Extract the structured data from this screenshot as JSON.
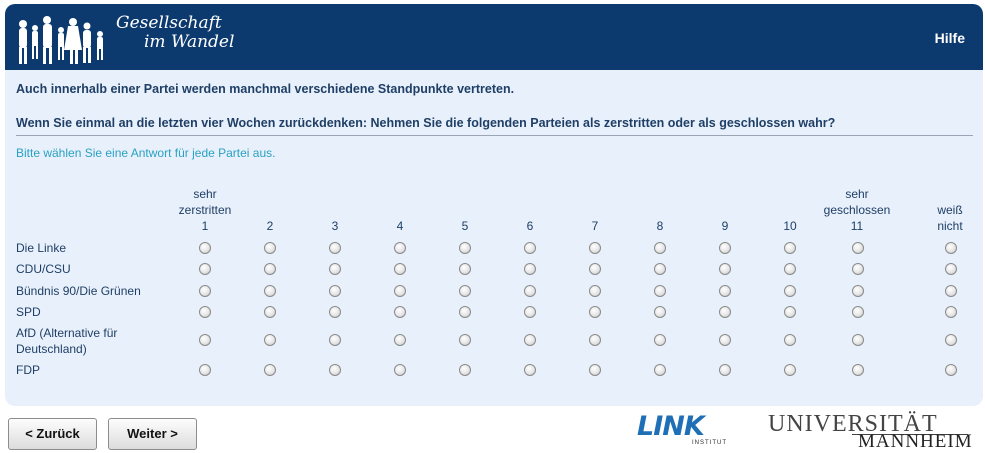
{
  "header": {
    "brand_line1": "Gesellschaft",
    "brand_line2": "im Wandel",
    "help_label": "Hilfe",
    "bg_color": "#0c3a6e"
  },
  "survey": {
    "intro": "Auch innerhalb einer Partei werden manchmal verschiedene Standpunkte vertreten.",
    "question": "Wenn Sie einmal an die letzten vier Wochen zurückdenken: Nehmen Sie die folgenden Parteien als zerstritten oder als geschlossen wahr?",
    "instruction": "Bitte wählen Sie eine Antwort für jede Partei aus.",
    "scale_labels": {
      "low_word1": "sehr",
      "low_word2": "zerstritten",
      "high_word1": "sehr",
      "high_word2": "geschlossen",
      "dk_word1": "weiß",
      "dk_word2": "nicht"
    },
    "columns": [
      "1",
      "2",
      "3",
      "4",
      "5",
      "6",
      "7",
      "8",
      "9",
      "10",
      "11"
    ],
    "rows": [
      {
        "label": "Die Linke"
      },
      {
        "label": "CDU/CSU"
      },
      {
        "label": "Bündnis 90/Die Grünen"
      },
      {
        "label": "SPD"
      },
      {
        "label": "AfD (Alternative für",
        "label2": "Deutschland)"
      },
      {
        "label": "FDP"
      }
    ]
  },
  "nav": {
    "back_label": "< Zurück",
    "next_label": "Weiter >"
  },
  "logos": {
    "link_word": "LINK",
    "link_sub": "INSTITUT",
    "uni_line1": "UNIVERSITÄT",
    "uni_line2": "MANNHEIM"
  }
}
